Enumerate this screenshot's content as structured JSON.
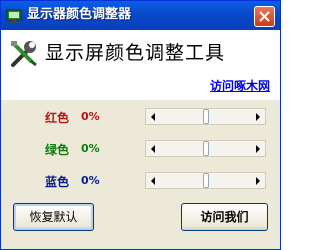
{
  "window": {
    "title": "显示器颜色调整器"
  },
  "header": {
    "heading": "显示屏颜色调整工具",
    "link": "访问啄木网"
  },
  "rows": [
    {
      "label": "红色",
      "percent": "0%",
      "value": 0.5
    },
    {
      "label": "绿色",
      "percent": "0%",
      "value": 0.5
    },
    {
      "label": "蓝色",
      "percent": "0%",
      "value": 0.5
    }
  ],
  "buttons": {
    "restore": "恢复默认",
    "visit": "访问我们"
  },
  "icons": {
    "app": "app-icon",
    "tool": "tools-icon",
    "close": "close-icon"
  }
}
